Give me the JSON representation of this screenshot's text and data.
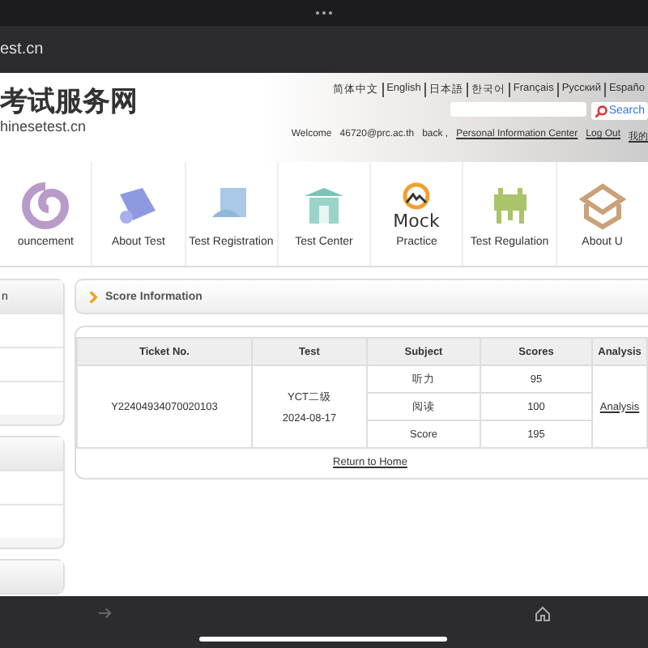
{
  "browser": {
    "url": "est.cn"
  },
  "header": {
    "logo_title": "考试服务网",
    "logo_domain": "hinesetest.cn",
    "languages": [
      "简体中文",
      "English",
      "日本語",
      "한국어",
      "Français",
      "Русский",
      "Españo"
    ],
    "search": {
      "button": "Search"
    },
    "welcome": {
      "greeting": "Welcome",
      "user": "46720@prc.ac.th",
      "suffix": "back ,",
      "links": [
        "Personal Information Center",
        "Log Out",
        "我的"
      ]
    }
  },
  "nav": [
    {
      "label": "ouncement",
      "kind": "swirl"
    },
    {
      "label": "About Test",
      "kind": "scroll"
    },
    {
      "label": "Test Registration",
      "kind": "register"
    },
    {
      "label": "Test Center",
      "kind": "building"
    },
    {
      "label": "Practice",
      "kind": "mock",
      "logo_text": "Mock"
    },
    {
      "label": "Test Regulation",
      "kind": "vessel"
    },
    {
      "label": "About U",
      "kind": "box"
    }
  ],
  "sidebar": {
    "title": "n"
  },
  "score": {
    "title": "Score Information",
    "columns": [
      "Ticket No.",
      "Test",
      "Subject",
      "Scores",
      "Analysis"
    ],
    "ticket": "Y22404934070020103",
    "test": "YCT二级",
    "date": "2024-08-17",
    "rows": [
      {
        "subject": "听力",
        "score": "95"
      },
      {
        "subject": "阅读",
        "score": "100"
      },
      {
        "subject": "Score",
        "score": "195"
      }
    ],
    "analysis": "Analysis",
    "return": "Return to Home"
  }
}
